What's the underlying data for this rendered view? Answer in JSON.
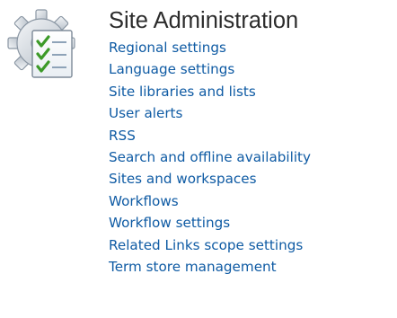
{
  "section": {
    "title": "Site Administration",
    "icon": "site-settings-gear-checklist-icon",
    "links": [
      {
        "label": "Regional settings"
      },
      {
        "label": "Language settings"
      },
      {
        "label": "Site libraries and lists"
      },
      {
        "label": "User alerts"
      },
      {
        "label": "RSS"
      },
      {
        "label": "Search and offline availability"
      },
      {
        "label": "Sites and workspaces"
      },
      {
        "label": "Workflows"
      },
      {
        "label": "Workflow settings"
      },
      {
        "label": "Related Links scope settings"
      },
      {
        "label": "Term store management"
      }
    ]
  },
  "colors": {
    "link": "#0f5ba4",
    "title": "#2c2c2c",
    "checkmark": "#3c9a28"
  }
}
